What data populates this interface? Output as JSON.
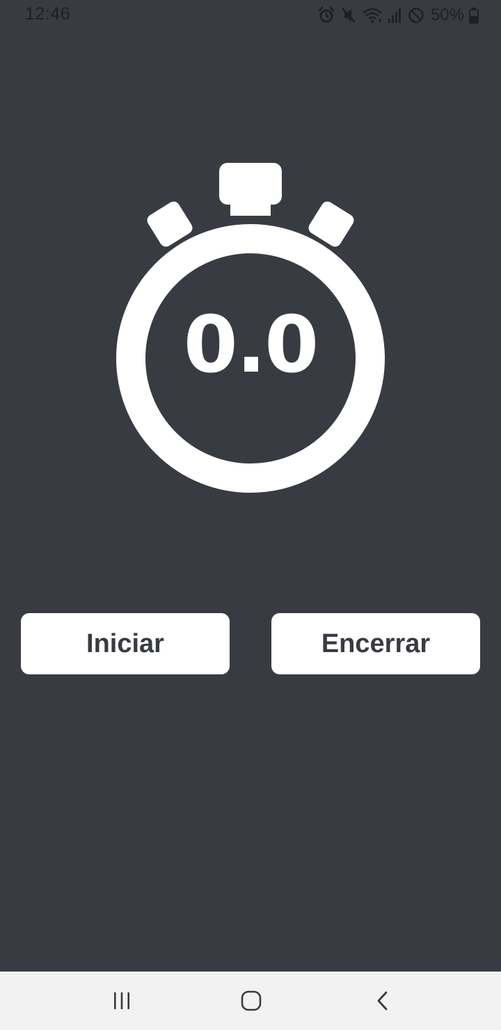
{
  "status_bar": {
    "time": "12:46",
    "battery": "50%",
    "icons": [
      "alarm-icon",
      "mute-icon",
      "wifi-icon",
      "signal-icon",
      "do-not-disturb-icon",
      "battery-icon"
    ]
  },
  "stopwatch": {
    "display_value": "0.0",
    "icon": "stopwatch-icon"
  },
  "buttons": {
    "start_label": "Iniciar",
    "stop_label": "Encerrar"
  },
  "nav_bar": {
    "icons": [
      "recents-icon",
      "home-icon",
      "back-icon"
    ]
  },
  "colors": {
    "background": "#393b43",
    "foreground": "#ffffff",
    "nav_bar": "#f2f2f2"
  }
}
